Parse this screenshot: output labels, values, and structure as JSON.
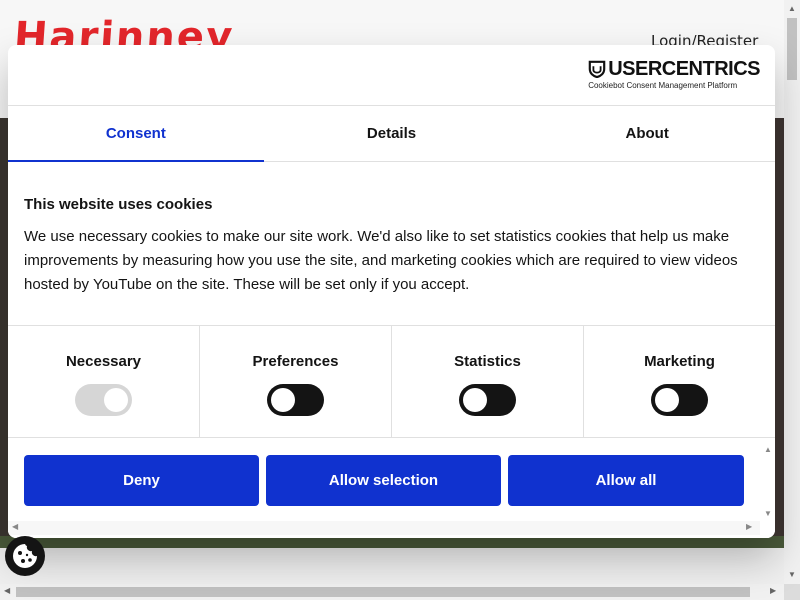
{
  "site": {
    "logo_text": "Harinney",
    "login_label": "Login/Register"
  },
  "dialog": {
    "brand": {
      "name": "USERCENTRICS",
      "subtitle": "Cookiebot Consent Management Platform"
    },
    "tabs": [
      {
        "label": "Consent",
        "active": true
      },
      {
        "label": "Details",
        "active": false
      },
      {
        "label": "About",
        "active": false
      }
    ],
    "heading": "This website uses cookies",
    "body": "We use necessary cookies to make our site work. We'd also like to set statistics cookies that help us make improvements by measuring how you use the site, and marketing cookies which are required to view videos hosted by YouTube on the site. These will be set only if you accept.",
    "categories": [
      {
        "label": "Necessary",
        "state": "on-disabled"
      },
      {
        "label": "Preferences",
        "state": "off"
      },
      {
        "label": "Statistics",
        "state": "off"
      },
      {
        "label": "Marketing",
        "state": "off"
      }
    ],
    "buttons": {
      "deny": "Deny",
      "allow_selection": "Allow selection",
      "allow_all": "Allow all"
    }
  },
  "colors": {
    "accent": "#1032cf",
    "logo": "#e3262b",
    "toggle_off": "#141414",
    "toggle_disabled": "#d6d6d6"
  },
  "icons": {
    "cookie_widget": "cookie-icon",
    "brand": "shield-icon"
  }
}
